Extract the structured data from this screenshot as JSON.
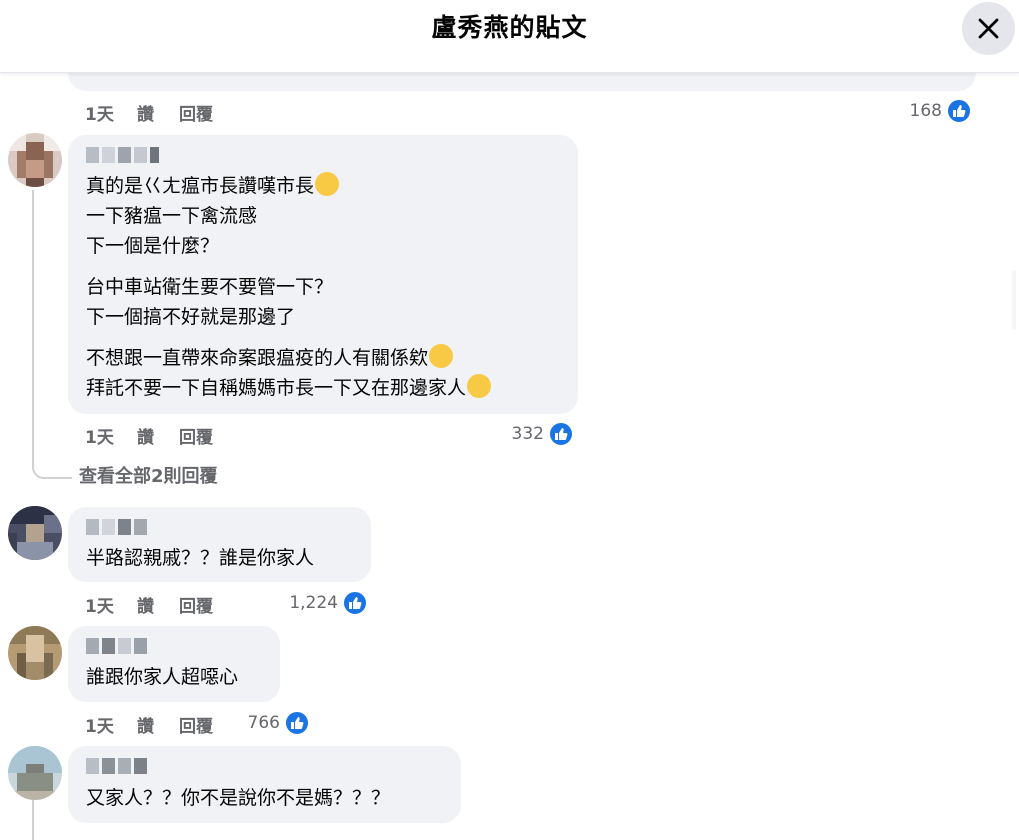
{
  "header": {
    "title": "盧秀燕的貼文",
    "close_icon": "close-icon"
  },
  "labels": {
    "like": "讚",
    "reply": "回覆"
  },
  "previous_comment": {
    "time": "1天",
    "like_count": "168"
  },
  "comments": [
    {
      "time": "1天",
      "like_count": "332",
      "lines": [
        "真的是巜ㄤ瘟市長讚嘆市長",
        "一下豬瘟一下禽流感",
        "下一個是什麼？",
        "台中車站衛生要不要管一下？",
        "下一個搞不好就是那邊了",
        "不想跟一直帶來命案跟瘟疫的人有關係欸",
        "拜託不要一下自稱媽媽市長一下又在那邊家人"
      ],
      "view_replies": "查看全部2則回覆"
    },
    {
      "time": "1天",
      "like_count": "1,224",
      "lines": [
        "半路認親戚？？誰是你家人"
      ]
    },
    {
      "time": "1天",
      "like_count": "766",
      "lines": [
        "誰跟你家人超噁心"
      ]
    },
    {
      "lines": [
        "又家人？？你不是說你不是媽？？？"
      ]
    }
  ],
  "colors": {
    "like_blue": "#1b74e4",
    "bubble_bg": "#f0f2f5",
    "meta_gray": "#65676b"
  }
}
